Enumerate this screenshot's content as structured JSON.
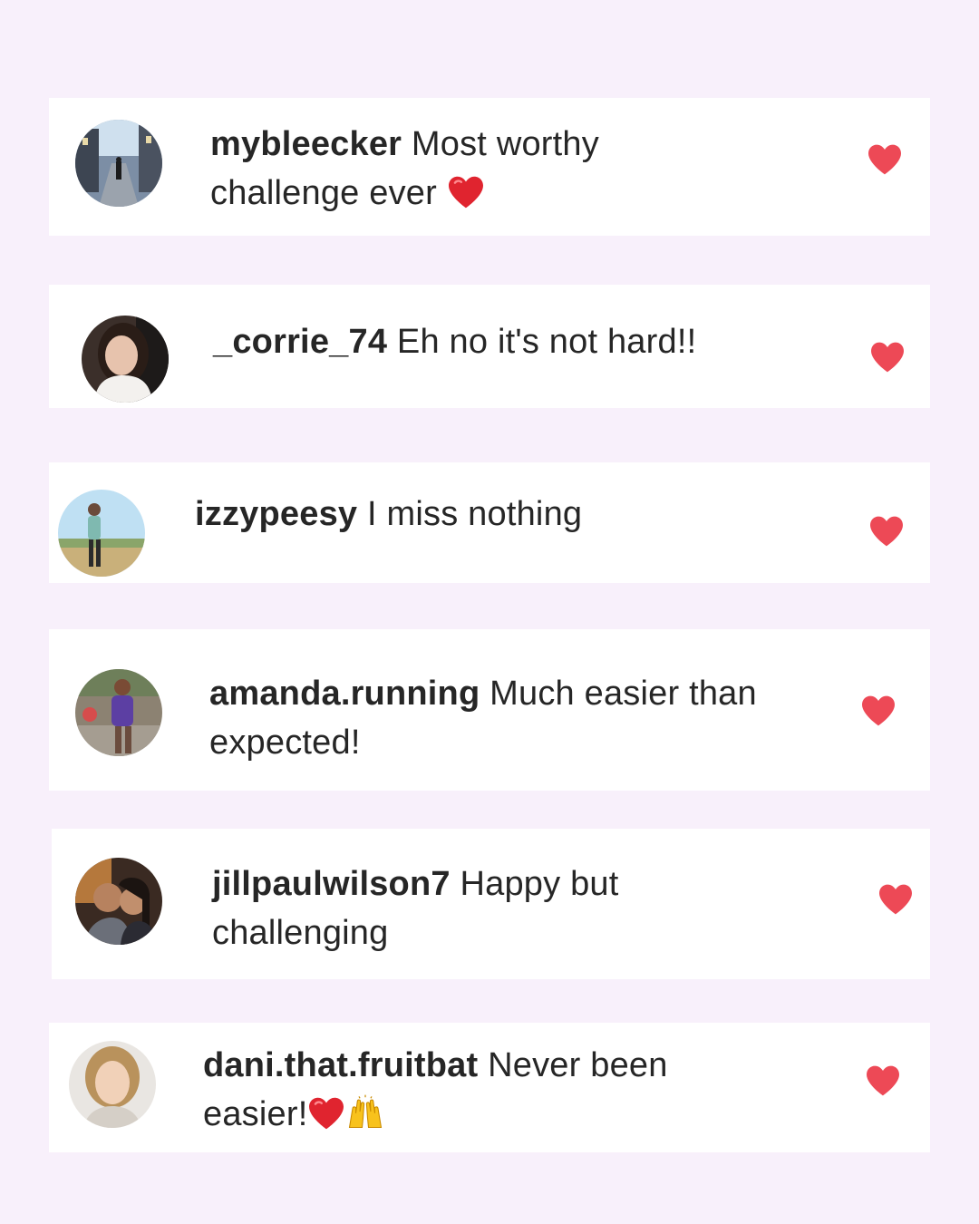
{
  "comments": [
    {
      "username": "mybleecker",
      "text_line1": " Most worthy",
      "text_line2": "challenge ever ",
      "avatar_icon": "city-street-photo",
      "trailing_emoji": "red-heart-emoji"
    },
    {
      "username": "_corrie_74",
      "text_line1": " Eh no it's not hard!!",
      "text_line2": "",
      "avatar_icon": "woman-portrait-photo"
    },
    {
      "username": "izzypeesy",
      "text_line1": " I miss nothing",
      "text_line2": "",
      "avatar_icon": "runner-field-photo"
    },
    {
      "username": "amanda.running",
      "text_line1": " Much easier than",
      "text_line2": "expected!",
      "avatar_icon": "race-runner-photo"
    },
    {
      "username": "jillpaulwilson7",
      "text_line1": " Happy but",
      "text_line2": "challenging",
      "avatar_icon": "couple-selfie-photo"
    },
    {
      "username": "dani.that.fruitbat",
      "text_line1": " Never been",
      "text_line2": "easier!",
      "avatar_icon": "smiling-woman-photo",
      "trailing_emoji": "red-heart-raised-hands-emoji"
    }
  ],
  "colors": {
    "background": "#f8f0fb",
    "card": "#ffffff",
    "like_heart": "#ed4956",
    "text": "#262626"
  }
}
